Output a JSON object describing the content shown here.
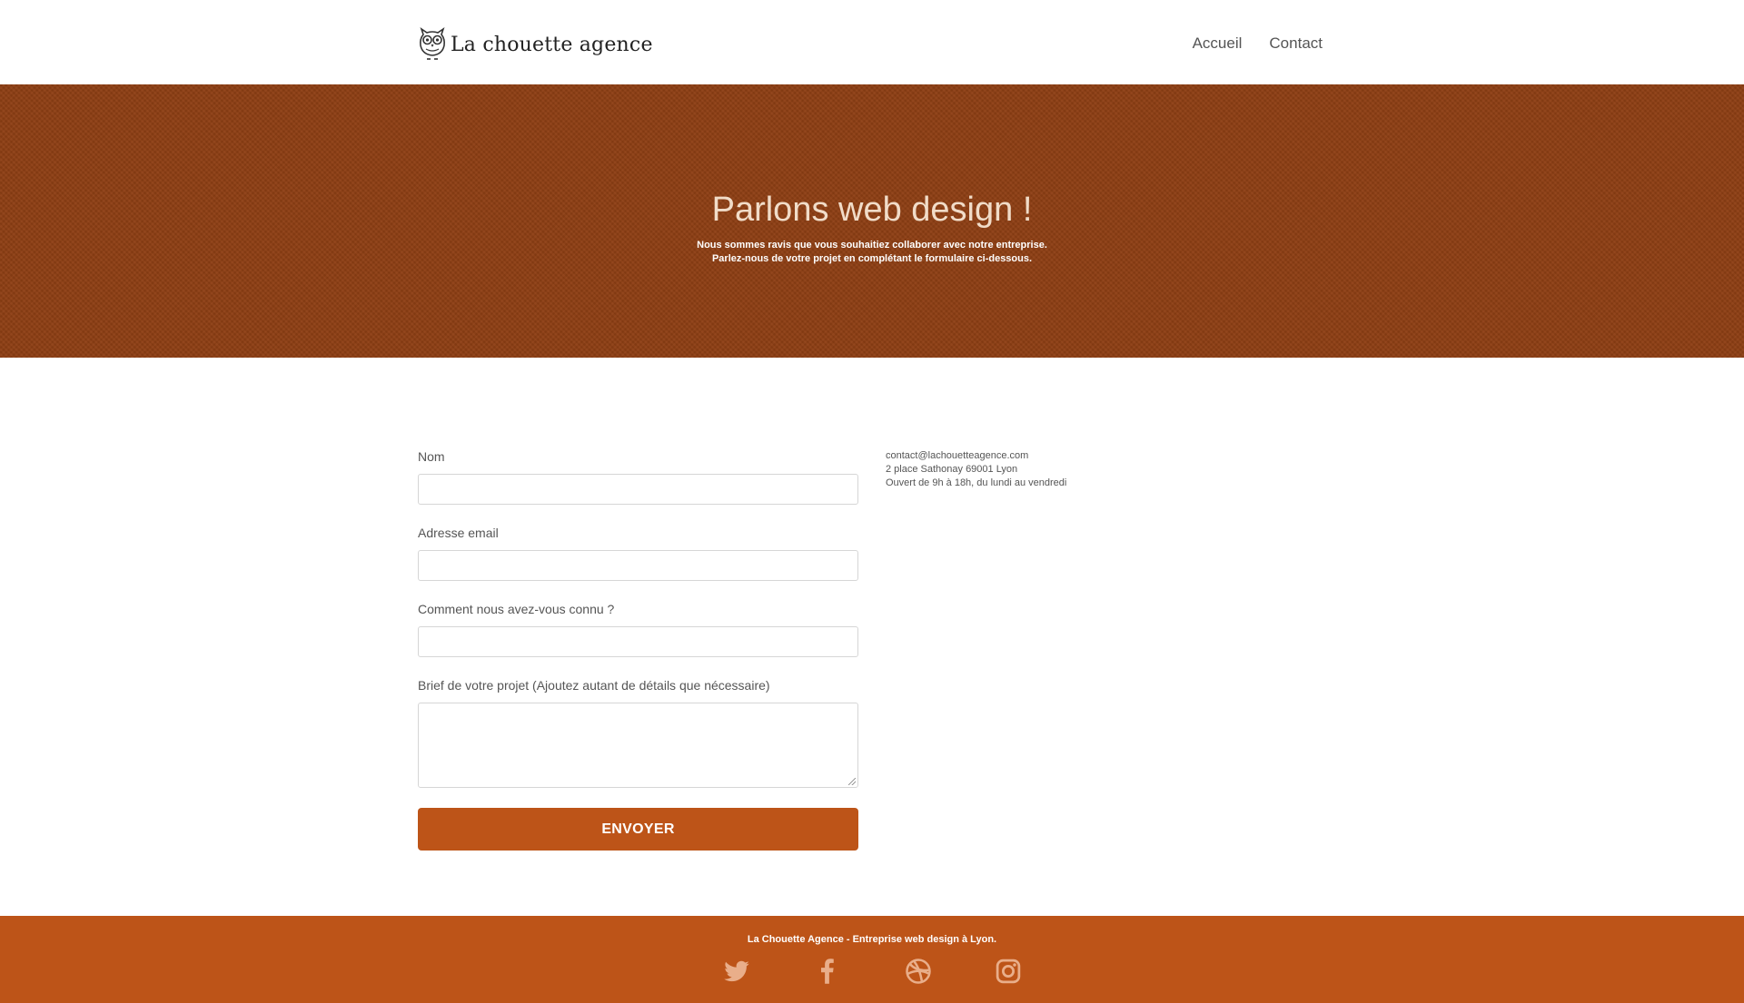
{
  "brand": {
    "name": "La chouette agence",
    "logo_icon": "owl-icon"
  },
  "nav": {
    "items": [
      {
        "label": "Accueil"
      },
      {
        "label": "Contact"
      }
    ]
  },
  "hero": {
    "title": "Parlons web design !",
    "line1": "Nous sommes ravis que vous souhaitiez collaborer avec notre entreprise.",
    "line2": "Parlez-nous de votre projet en complétant le formulaire ci-dessous."
  },
  "form": {
    "name_label": "Nom",
    "name_value": "",
    "email_label": "Adresse email",
    "email_value": "",
    "source_label": "Comment nous avez-vous connu ?",
    "source_value": "",
    "brief_label": "Brief de votre projet (Ajoutez autant de détails que nécessaire)",
    "brief_value": "",
    "submit_label": "ENVOYER"
  },
  "contact_info": {
    "email": "contact@lachouetteagence.com",
    "address": "2 place Sathonay 69001 Lyon",
    "hours": "Ouvert de 9h à 18h, du lundi au vendredi"
  },
  "footer": {
    "text": "La Chouette Agence - Entreprise web design à Lyon.",
    "socials": [
      "twitter-icon",
      "facebook-icon",
      "dribbble-icon",
      "instagram-icon"
    ]
  },
  "colors": {
    "accent": "#bd5418",
    "hero_bg": "#8f3f14",
    "hero_title": "#f1dcc8",
    "social_icon": "#e9ae8a"
  }
}
